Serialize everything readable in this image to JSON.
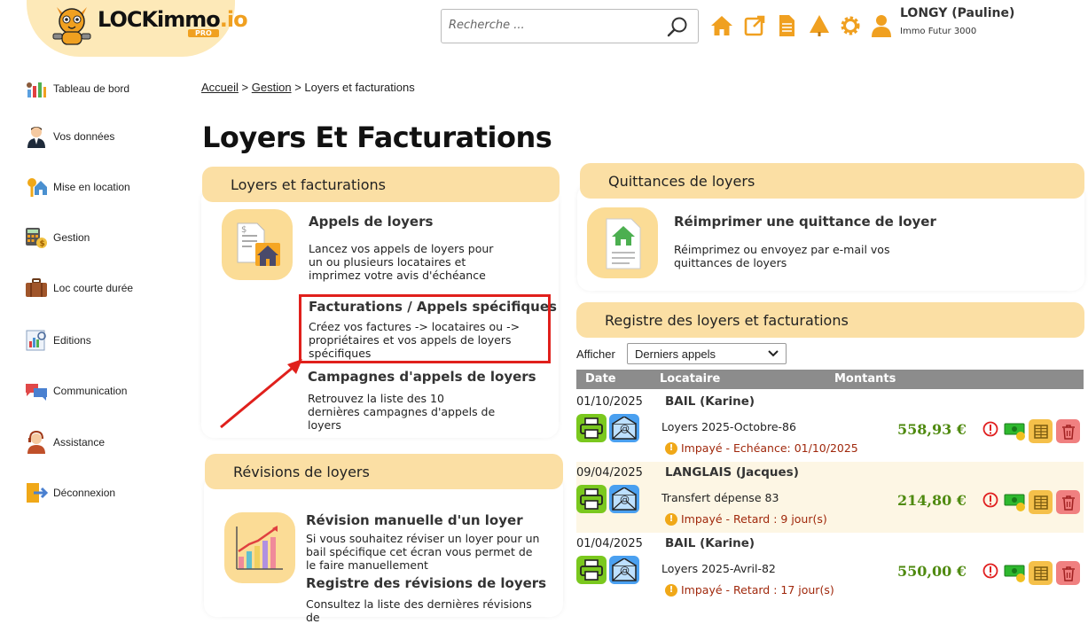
{
  "header": {
    "logo_main": "LOCKimmo",
    "logo_suffix": ".io",
    "logo_badge": "PRO",
    "search_placeholder": "Recherche ...",
    "user_name": "LONGY (Pauline)",
    "user_company": "Immo Futur 3000",
    "icons": [
      "home-icon",
      "external-link-icon",
      "document-icon",
      "tree-icon",
      "gear-icon",
      "user-icon"
    ],
    "accent_color": "#f0a020"
  },
  "sidebar": {
    "items": [
      {
        "label": "Tableau de bord",
        "icon": "dashboard-icon"
      },
      {
        "label": "Vos données",
        "icon": "person-icon"
      },
      {
        "label": "Mise en location",
        "icon": "house-key-icon"
      },
      {
        "label": "Gestion",
        "icon": "calculator-icon"
      },
      {
        "label": "Loc courte durée",
        "icon": "suitcase-icon"
      },
      {
        "label": "Editions",
        "icon": "report-icon"
      },
      {
        "label": "Communication",
        "icon": "chat-icon"
      },
      {
        "label": "Assistance",
        "icon": "headset-icon"
      },
      {
        "label": "Déconnexion",
        "icon": "logout-icon"
      }
    ]
  },
  "breadcrumb": {
    "home": "Accueil",
    "sep": ">",
    "gestion": "Gestion",
    "current": "Loyers et facturations"
  },
  "page_title": "Loyers Et Facturations",
  "loyers_card": {
    "title": "Loyers et facturations",
    "appels_title": "Appels de loyers",
    "appels_desc": "Lancez vos appels de loyers pour un ou plusieurs locataires et imprimez votre avis d'échéance",
    "fact_title": "Facturations / Appels spécifiques",
    "fact_desc": "Créez vos factures -> locataires ou -> propriétaires et vos appels de loyers spécifiques",
    "camp_title": "Campagnes d'appels de loyers",
    "camp_desc": "Retrouvez la liste des 10 dernières campagnes d'appels de loyers"
  },
  "revisions_card": {
    "title": "Révisions de loyers",
    "manuelle_title": "Révision manuelle d'un loyer",
    "manuelle_desc": "Si vous souhaitez réviser un loyer pour un bail spécifique cet écran vous permet de le faire manuellement",
    "registre_title": "Registre des révisions de loyers",
    "registre_desc": "Consultez la liste des dernières révisions de"
  },
  "quittances_card": {
    "title": "Quittances de loyers",
    "reimp_title": "Réimprimer une quittance de loyer",
    "reimp_desc": "Réimprimez ou envoyez par e-mail vos quittances de loyers"
  },
  "registre": {
    "title": "Registre des loyers et facturations",
    "afficher_label": "Afficher",
    "select_value": "Derniers appels",
    "col_date": "Date",
    "col_locataire": "Locataire",
    "col_montants": "Montants",
    "rows": [
      {
        "date": "01/10/2025",
        "tenant": "BAIL (Karine)",
        "libelle": "Loyers 2025-Octobre-86",
        "status": "Impayé - Echéance: 01/10/2025",
        "amount": "558,93 €"
      },
      {
        "date": "09/04/2025",
        "tenant": "LANGLAIS (Jacques)",
        "libelle": "Transfert dépense 83",
        "status": "Impayé - Retard : 9 jour(s)",
        "amount": "214,80 €"
      },
      {
        "date": "01/04/2025",
        "tenant": "BAIL (Karine)",
        "libelle": "Loyers 2025-Avril-82",
        "status": "Impayé - Retard : 17 jour(s)",
        "amount": "550,00 €"
      }
    ],
    "row_backgrounds": [
      "#ffffff",
      "#fdf6e4",
      "#ffffff"
    ]
  }
}
